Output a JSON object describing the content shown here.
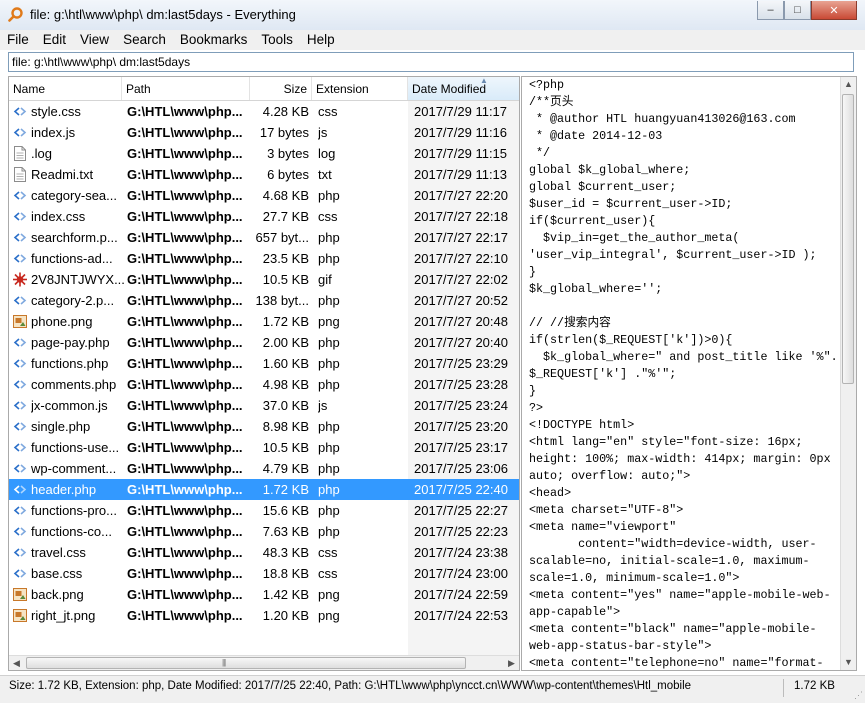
{
  "window": {
    "title": "file: g:\\htl\\www\\php\\ dm:last5days - Everything",
    "minimize": "‒",
    "maximize": "□",
    "close": "✕"
  },
  "menu": [
    "File",
    "Edit",
    "View",
    "Search",
    "Bookmarks",
    "Tools",
    "Help"
  ],
  "search": {
    "value": "file: g:\\htl\\www\\php\\ dm:last5days"
  },
  "columns": {
    "name": "Name",
    "path": "Path",
    "size": "Size",
    "extension": "Extension",
    "date": "Date Modified",
    "sorted_by": "Date Modified",
    "sort_arrow": "▲"
  },
  "files": [
    {
      "name": "style.css",
      "path": "G:\\HTL\\www\\php...",
      "size": "4.28 KB",
      "ext": "css",
      "date": "2017/7/29 11:17",
      "icon": "code-file-icon"
    },
    {
      "name": "index.js",
      "path": "G:\\HTL\\www\\php...",
      "size": "17 bytes",
      "ext": "js",
      "date": "2017/7/29 11:16",
      "icon": "code-file-icon"
    },
    {
      "name": ".log",
      "path": "G:\\HTL\\www\\php...",
      "size": "3 bytes",
      "ext": "log",
      "date": "2017/7/29 11:15",
      "icon": "text-file-icon"
    },
    {
      "name": "Readmi.txt",
      "path": "G:\\HTL\\www\\php...",
      "size": "6 bytes",
      "ext": "txt",
      "date": "2017/7/29 11:13",
      "icon": "text-file-icon"
    },
    {
      "name": "category-sea...",
      "path": "G:\\HTL\\www\\php...",
      "size": "4.68 KB",
      "ext": "php",
      "date": "2017/7/27 22:20",
      "icon": "code-file-icon"
    },
    {
      "name": "index.css",
      "path": "G:\\HTL\\www\\php...",
      "size": "27.7 KB",
      "ext": "css",
      "date": "2017/7/27 22:18",
      "icon": "code-file-icon"
    },
    {
      "name": "searchform.p...",
      "path": "G:\\HTL\\www\\php...",
      "size": "657 byt...",
      "ext": "php",
      "date": "2017/7/27 22:17",
      "icon": "code-file-icon"
    },
    {
      "name": "functions-ad...",
      "path": "G:\\HTL\\www\\php...",
      "size": "23.5 KB",
      "ext": "php",
      "date": "2017/7/27 22:10",
      "icon": "code-file-icon"
    },
    {
      "name": "2V8JNTJWYX...",
      "path": "G:\\HTL\\www\\php...",
      "size": "10.5 KB",
      "ext": "gif",
      "date": "2017/7/27 22:02",
      "icon": "gif-file-icon"
    },
    {
      "name": "category-2.p...",
      "path": "G:\\HTL\\www\\php...",
      "size": "138 byt...",
      "ext": "php",
      "date": "2017/7/27 20:52",
      "icon": "code-file-icon"
    },
    {
      "name": "phone.png",
      "path": "G:\\HTL\\www\\php...",
      "size": "1.72 KB",
      "ext": "png",
      "date": "2017/7/27 20:48",
      "icon": "image-file-icon"
    },
    {
      "name": "page-pay.php",
      "path": "G:\\HTL\\www\\php...",
      "size": "2.00 KB",
      "ext": "php",
      "date": "2017/7/27 20:40",
      "icon": "code-file-icon"
    },
    {
      "name": "functions.php",
      "path": "G:\\HTL\\www\\php...",
      "size": "1.60 KB",
      "ext": "php",
      "date": "2017/7/25 23:29",
      "icon": "code-file-icon"
    },
    {
      "name": "comments.php",
      "path": "G:\\HTL\\www\\php...",
      "size": "4.98 KB",
      "ext": "php",
      "date": "2017/7/25 23:28",
      "icon": "code-file-icon"
    },
    {
      "name": "jx-common.js",
      "path": "G:\\HTL\\www\\php...",
      "size": "37.0 KB",
      "ext": "js",
      "date": "2017/7/25 23:24",
      "icon": "code-file-icon"
    },
    {
      "name": "single.php",
      "path": "G:\\HTL\\www\\php...",
      "size": "8.98 KB",
      "ext": "php",
      "date": "2017/7/25 23:20",
      "icon": "code-file-icon"
    },
    {
      "name": "functions-use...",
      "path": "G:\\HTL\\www\\php...",
      "size": "10.5 KB",
      "ext": "php",
      "date": "2017/7/25 23:17",
      "icon": "code-file-icon"
    },
    {
      "name": "wp-comment...",
      "path": "G:\\HTL\\www\\php...",
      "size": "4.79 KB",
      "ext": "php",
      "date": "2017/7/25 23:06",
      "icon": "code-file-icon"
    },
    {
      "name": "header.php",
      "path": "G:\\HTL\\www\\php...",
      "size": "1.72 KB",
      "ext": "php",
      "date": "2017/7/25 22:40",
      "icon": "code-file-icon",
      "selected": true
    },
    {
      "name": "functions-pro...",
      "path": "G:\\HTL\\www\\php...",
      "size": "15.6 KB",
      "ext": "php",
      "date": "2017/7/25 22:27",
      "icon": "code-file-icon"
    },
    {
      "name": "functions-co...",
      "path": "G:\\HTL\\www\\php...",
      "size": "7.63 KB",
      "ext": "php",
      "date": "2017/7/25 22:23",
      "icon": "code-file-icon"
    },
    {
      "name": "travel.css",
      "path": "G:\\HTL\\www\\php...",
      "size": "48.3 KB",
      "ext": "css",
      "date": "2017/7/24 23:38",
      "icon": "code-file-icon"
    },
    {
      "name": "base.css",
      "path": "G:\\HTL\\www\\php...",
      "size": "18.8 KB",
      "ext": "css",
      "date": "2017/7/24 23:00",
      "icon": "code-file-icon"
    },
    {
      "name": "back.png",
      "path": "G:\\HTL\\www\\php...",
      "size": "1.42 KB",
      "ext": "png",
      "date": "2017/7/24 22:59",
      "icon": "image-file-icon"
    },
    {
      "name": "right_jt.png",
      "path": "G:\\HTL\\www\\php...",
      "size": "1.20 KB",
      "ext": "png",
      "date": "2017/7/24 22:53",
      "icon": "image-file-icon"
    }
  ],
  "preview_lines": [
    "<?php",
    "/**页头",
    " * @author HTL huangyuan413026@163.com",
    " * @date 2014-12-03",
    " */",
    "global $k_global_where;",
    "global $current_user;",
    "$user_id = $current_user->ID;",
    "if($current_user){",
    "  $vip_in=get_the_author_meta(",
    "'user_vip_integral', $current_user->ID );",
    "}",
    "$k_global_where='';",
    "",
    "// //搜索内容",
    "if(strlen($_REQUEST['k'])>0){",
    "  $k_global_where=\" and post_title like '%\".",
    "$_REQUEST['k'] .\"%'\";",
    "}",
    "?>",
    "<!DOCTYPE html>",
    "<html lang=\"en\" style=\"font-size: 16px;",
    "height: 100%; max-width: 414px; margin: 0px",
    "auto; overflow: auto;\">",
    "<head>",
    "<meta charset=\"UTF-8\">",
    "<meta name=\"viewport\"",
    "       content=\"width=device-width, user-",
    "scalable=no, initial-scale=1.0, maximum-",
    "scale=1.0, minimum-scale=1.0\">",
    "<meta content=\"yes\" name=\"apple-mobile-web-",
    "app-capable\">",
    "<meta content=\"black\" name=\"apple-mobile-",
    "web-app-status-bar-style\">",
    "<meta content=\"telephone=no\" name=\"format-"
  ],
  "status": {
    "text": "Size: 1.72 KB, Extension: php, Date Modified: 2017/7/25 22:40, Path: G:\\HTL\\www\\php\\yncct.cn\\WWW\\wp-content\\themes\\Htl_mobile",
    "size": "1.72 KB"
  },
  "scroll": {
    "up": "▲",
    "down": "▼",
    "left": "◀",
    "right": "▶",
    "grip": "|||",
    "corner": "⋰"
  },
  "colors": {
    "selection": "#3399ff",
    "code_icon": "#2a6fc9",
    "gif_icon": "#c8281e",
    "image_icon": "#c8782a"
  }
}
